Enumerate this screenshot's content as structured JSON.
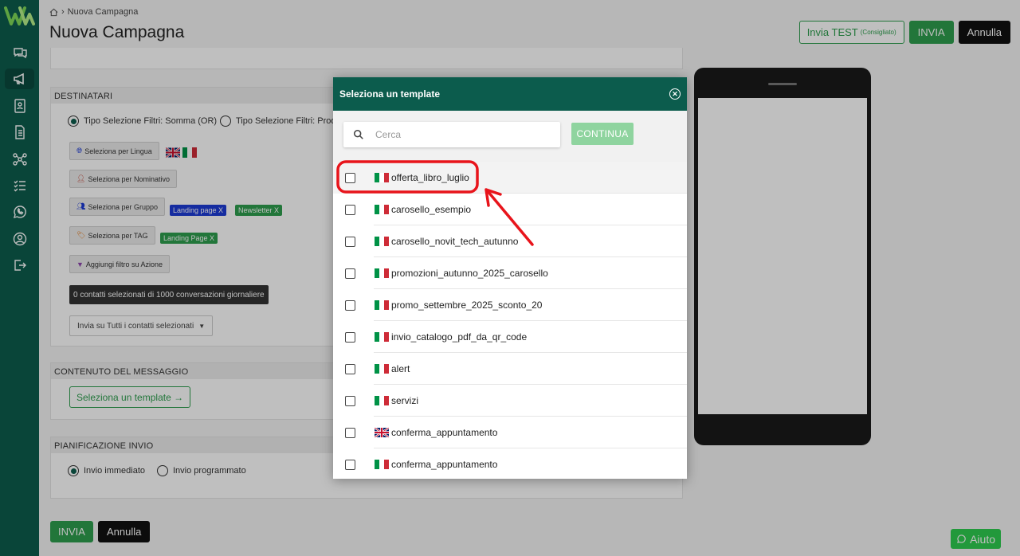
{
  "sidebar": {
    "logo": "logo-w",
    "items": [
      {
        "icon": "chat-icon"
      },
      {
        "icon": "megaphone-icon",
        "active": true
      },
      {
        "icon": "contacts-icon"
      },
      {
        "icon": "document-icon"
      },
      {
        "icon": "flow-icon"
      },
      {
        "icon": "checklist-icon"
      },
      {
        "icon": "whatsapp-icon"
      },
      {
        "icon": "user-icon"
      },
      {
        "icon": "logout-icon"
      }
    ]
  },
  "header": {
    "breadcrumb": "Nuova Campagna",
    "title": "Nuova Campagna",
    "btn_test": "Invia TEST",
    "btn_test_note": "(Consigliato)",
    "btn_send": "INVIA",
    "btn_cancel": "Annulla"
  },
  "recipients": {
    "heading": "DESTINATARI",
    "radio_sum": "Tipo Selezione Filtri: Somma (OR)",
    "radio_product": "Tipo Selezione Filtri: Prodo",
    "btn_language": "Seleziona per Lingua",
    "btn_name": "Seleziona per Nominativo",
    "btn_group": "Seleziona per Gruppo",
    "tag_landing_group": "Landing page X",
    "tag_newsletter": "Newsletter X",
    "btn_tag": "Seleziona per TAG",
    "tag_landing_tag": "Landing Page  X",
    "btn_action_filter": "Aggiungi filtro su Azione",
    "counter": "0 contatti selezionati di 1000 conversazioni giornaliere",
    "send_mode": "Invia su Tutti i contatti selezionati"
  },
  "content": {
    "heading": "CONTENUTO DEL MESSAGGIO",
    "btn_template": "Seleziona un template →"
  },
  "schedule": {
    "heading": "PIANIFICAZIONE INVIO",
    "radio_now": "Invio immediato",
    "radio_later": "Invio programmato"
  },
  "footer": {
    "btn_send": "INVIA",
    "btn_cancel": "Annulla",
    "help": "Aiuto"
  },
  "modal": {
    "title": "Seleziona un template",
    "search_placeholder": "Cerca",
    "continue": "CONTINUA",
    "templates": [
      {
        "name": "offerta_libro_luglio",
        "flag": "it"
      },
      {
        "name": "carosello_esempio",
        "flag": "it"
      },
      {
        "name": "carosello_novit_tech_autunno",
        "flag": "it"
      },
      {
        "name": "promozioni_autunno_2025_carosello",
        "flag": "it"
      },
      {
        "name": "promo_settembre_2025_sconto_20",
        "flag": "it"
      },
      {
        "name": "invio_catalogo_pdf_da_qr_code",
        "flag": "it"
      },
      {
        "name": "alert",
        "flag": "it"
      },
      {
        "name": "servizi",
        "flag": "it"
      },
      {
        "name": "conferma_appuntamento",
        "flag": "uk"
      },
      {
        "name": "conferma_appuntamento",
        "flag": "it"
      }
    ]
  },
  "colors": {
    "brand": "#0c5c4d",
    "accent_green": "#2e9e4e",
    "annotation_red": "#e8141b"
  }
}
